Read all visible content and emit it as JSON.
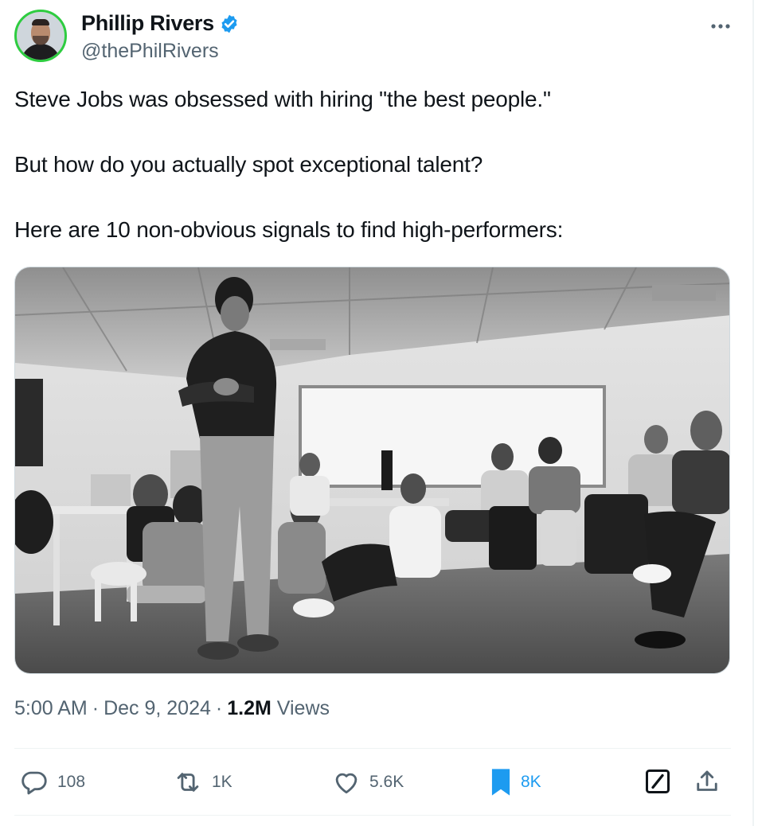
{
  "author": {
    "name": "Phillip Rivers",
    "handle": "@thePhilRivers",
    "verified": true,
    "more_icon": "more-icon"
  },
  "tweet": {
    "paragraphs": [
      "Steve Jobs was obsessed with hiring \"the best people.\"",
      "But how do you actually spot exceptional talent?",
      "Here are 10 non-obvious signals to find high-performers:"
    ]
  },
  "meta": {
    "time": "5:00 AM",
    "date": "Dec 9, 2024",
    "views_count": "1.2M",
    "views_label": "Views",
    "separator": "·"
  },
  "actions": {
    "replies": "108",
    "reposts": "1K",
    "likes": "5.6K",
    "bookmarks": "8K"
  },
  "colors": {
    "accent": "#1d9bf0",
    "text": "#0f1419",
    "muted": "#536471",
    "avatar_ring": "#2ecc40"
  }
}
